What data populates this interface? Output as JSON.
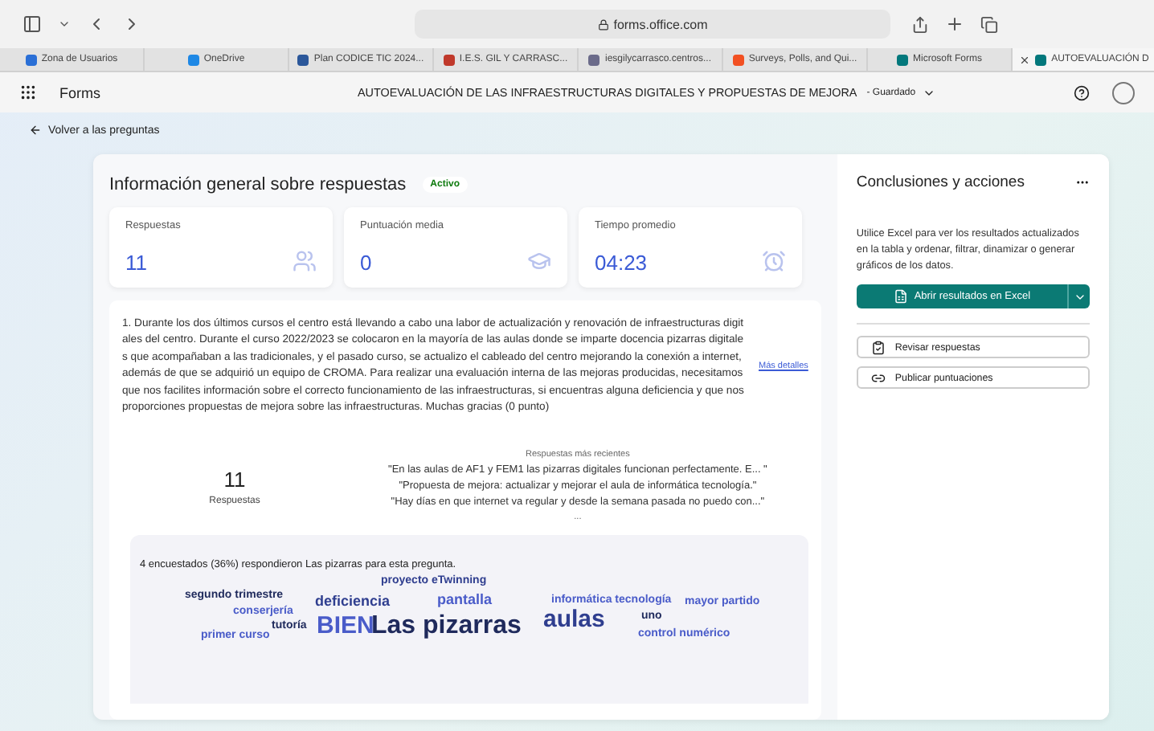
{
  "browser": {
    "url": "forms.office.com"
  },
  "tabs": [
    {
      "label": "Zona de Usuarios",
      "selected": false,
      "color": "#2a6fd6"
    },
    {
      "label": "OneDrive",
      "selected": false,
      "color": "#1e88e5"
    },
    {
      "label": "Plan CODICE TIC 2024...",
      "selected": false,
      "color": "#2b579a"
    },
    {
      "label": "I.E.S. GIL Y CARRASC...",
      "selected": false,
      "color": "#c0392b"
    },
    {
      "label": "iesgilycarrasco.centros...",
      "selected": false,
      "color": "#6b6b8a"
    },
    {
      "label": "Surveys, Polls, and Qui...",
      "selected": false,
      "color": "#f25022"
    },
    {
      "label": "Microsoft Forms",
      "selected": false,
      "color": "#03787c"
    },
    {
      "label": "AUTOEVALUACIÓN D",
      "selected": true,
      "color": "#03787c"
    }
  ],
  "app": {
    "name": "Forms",
    "title": "AUTOEVALUACIÓN DE LAS INFRAESTRUCTURAS DIGITALES Y PROPUESTAS DE MEJORA",
    "save_state": "- Guardado"
  },
  "back_link": "Volver a las preguntas",
  "overview": {
    "title": "Información general sobre respuestas",
    "status": "Activo",
    "stats": [
      {
        "kind": "people",
        "label": "Respuestas",
        "value": "11"
      },
      {
        "kind": "cap",
        "label": "Puntuación media",
        "value": "0"
      },
      {
        "kind": "clock",
        "label": "Tiempo promedio",
        "value": "04:23"
      }
    ]
  },
  "question": {
    "text": "1. Durante los dos últimos cursos el centro está llevando a cabo una labor de actualización y renovación de infraestructuras digitales del centro. Durante el curso 2022/2023 se colocaron en la mayoría de las aulas donde se imparte docencia pizarras digitales que acompañaban a las tradicionales, y el pasado curso, se actualizo el cableado del centro mejorando la conexión a internet, además de que se adquirió un equipo de CROMA. Para realizar una evaluación interna de las mejoras producidas, necesitamos que nos facilites información sobre el correcto funcionamiento de las infraestructuras, si encuentras alguna deficiencia y que nos proporciones propuestas de mejora sobre las infraestructuras. Muchas gracias (0 punto)",
    "details_link": "Más detalles",
    "count": "11",
    "count_label": "Respuestas",
    "recent_title": "Respuestas más recientes",
    "recent": [
      "\"En las aulas de AF1 y FEM1 las pizarras digitales funcionan perfectamente. E... \"",
      "\"Propuesta de mejora: actualizar y mejorar el aula de informática tecnología.\"",
      "\"Hay días en que internet va regular y desde la semana pasada no puedo con...\""
    ],
    "more": "...",
    "summary": "4 encuestados (36%) respondieron Las pizarras para esta pregunta.",
    "words": [
      {
        "text": "segundo trimestre",
        "kind": "s",
        "color": "#1f2a5c"
      },
      {
        "text": "conserjería",
        "kind": "s",
        "color": "#4a5cc9"
      },
      {
        "text": "primer curso",
        "kind": "s",
        "color": "#4a5cc9"
      },
      {
        "text": "tutoría",
        "kind": "s",
        "color": "#1f2a5c"
      },
      {
        "text": "deficiencia",
        "kind": "m",
        "color": "#2f3e8f"
      },
      {
        "text": "BIEN",
        "kind": "l",
        "color": "#4a5cc9"
      },
      {
        "text": "proyecto eTwinning",
        "kind": "s",
        "color": "#2f3e8f"
      },
      {
        "text": "pantalla",
        "kind": "m",
        "color": "#4a5cc9"
      },
      {
        "text": "Las pizarras",
        "kind": "xl",
        "color": "#1f2a5c"
      },
      {
        "text": "informática tecnología",
        "kind": "s",
        "color": "#4a5cc9"
      },
      {
        "text": "aulas",
        "kind": "l",
        "color": "#2f3e8f"
      },
      {
        "text": "mayor partido",
        "kind": "s",
        "color": "#4a5cc9"
      },
      {
        "text": "uno",
        "kind": "s",
        "color": "#1f2a5c"
      },
      {
        "text": "control numérico",
        "kind": "s",
        "color": "#4a5cc9"
      }
    ]
  },
  "side": {
    "title": "Conclusiones y acciones",
    "text": "Utilice Excel para ver los resultados actualizados en la tabla y ordenar, filtrar, dinamizar o generar gráficos de los datos.",
    "excel_button": "Abrir resultados en Excel",
    "actions": [
      {
        "kind": "review",
        "label": "Revisar respuestas"
      },
      {
        "kind": "publish",
        "label": "Publicar puntuaciones"
      }
    ]
  }
}
